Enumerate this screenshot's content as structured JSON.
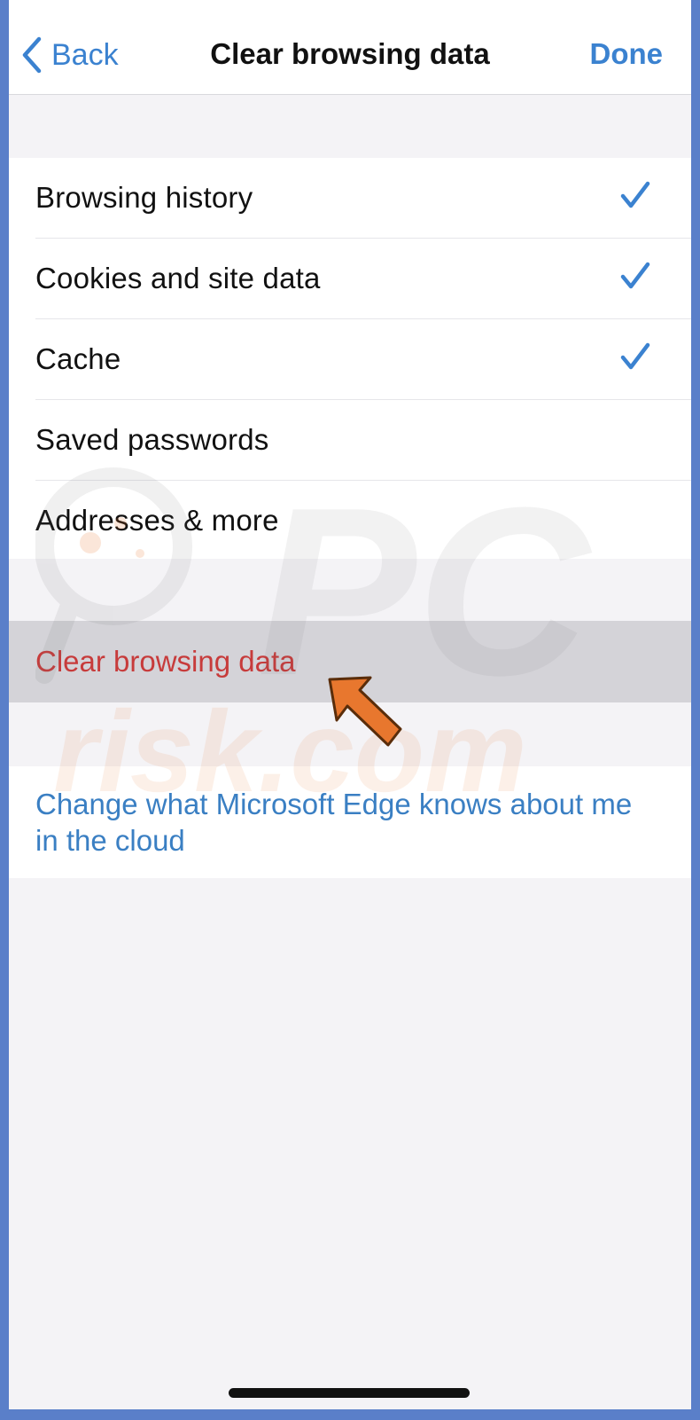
{
  "nav": {
    "back_label": "Back",
    "title": "Clear browsing data",
    "done_label": "Done"
  },
  "data_types": [
    {
      "label": "Browsing history",
      "checked": true
    },
    {
      "label": "Cookies and site data",
      "checked": true
    },
    {
      "label": "Cache",
      "checked": true
    },
    {
      "label": "Saved passwords",
      "checked": false
    },
    {
      "label": "Addresses & more",
      "checked": false
    }
  ],
  "action": {
    "label": "Clear browsing data"
  },
  "cloud": {
    "link_label": "Change what Microsoft Edge knows about me in the cloud"
  },
  "watermark": {
    "top_text": "PC",
    "bottom_text": "risk.com"
  },
  "colors": {
    "accent": "#3b82d0",
    "destructive": "#c73b3b",
    "frame": "#5a7fc9",
    "arrow": "#e8772e"
  },
  "icons": {
    "back": "chevron-left-icon",
    "check": "checkmark-icon",
    "pointer": "arrow-pointer-icon"
  }
}
